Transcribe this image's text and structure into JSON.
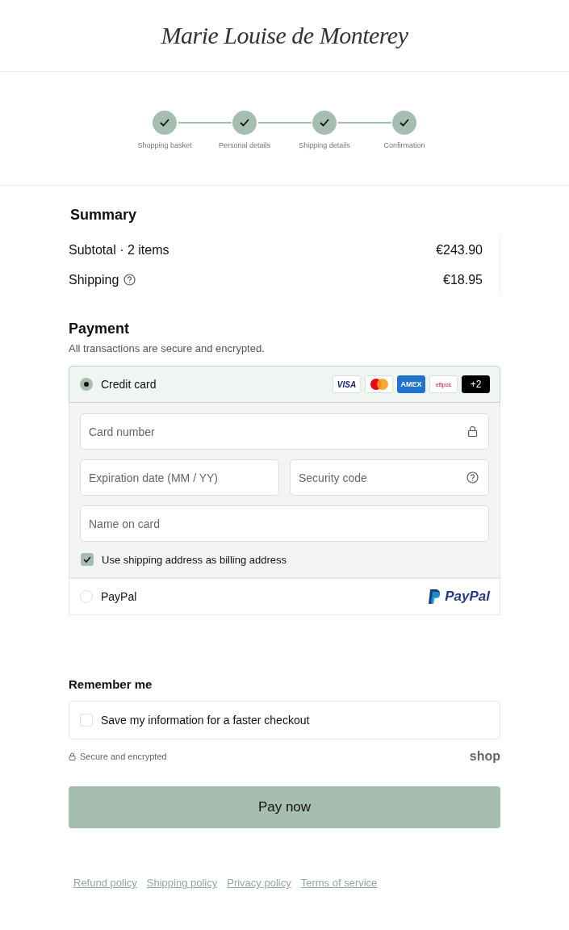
{
  "logo": "Marie Louise de Monterey",
  "steps": [
    {
      "label": "Shopping basket",
      "done": true
    },
    {
      "label": "Personal details",
      "done": true
    },
    {
      "label": "Shipping details",
      "done": true
    },
    {
      "label": "Confirmation",
      "done": true
    }
  ],
  "summary": {
    "title": "Summary",
    "rows": [
      {
        "label": "Subtotal · 2 items",
        "value": "€243.90",
        "help": false
      },
      {
        "label": "Shipping",
        "value": "€18.95",
        "help": true
      }
    ]
  },
  "payment": {
    "title": "Payment",
    "subtitle": "All transactions are secure and encrypted.",
    "methods": [
      {
        "kind": "card",
        "label": "Credit card",
        "selected": true,
        "brands": [
          {
            "kind": "visa",
            "text": "VISA"
          },
          {
            "kind": "mastercard"
          },
          {
            "kind": "amex",
            "text": "AMEX"
          },
          {
            "kind": "eftpos",
            "text": "eftpos"
          },
          {
            "kind": "more",
            "text": "+2"
          }
        ],
        "fields": [
          {
            "placeholder": "Card number"
          },
          {
            "placeholder": "Expiration date (MM / YY)"
          },
          {
            "placeholder": "Security code"
          },
          {
            "placeholder": "Name on card"
          }
        ],
        "billing": {
          "label": "Use shipping address as billing address",
          "checked": true
        }
      },
      {
        "kind": "paypal",
        "label": "PayPal",
        "selected": false,
        "logo": "PayPal"
      }
    ]
  },
  "remember": {
    "title": "Remember me",
    "label": "Save my information for a faster checkout",
    "checked": false
  },
  "secure_note": "Secure and encrypted",
  "shop_logo": "shop",
  "pay_button": "Pay now",
  "footer_links": [
    "Refund policy",
    "Shipping policy",
    "Privacy policy",
    "Terms of service"
  ]
}
